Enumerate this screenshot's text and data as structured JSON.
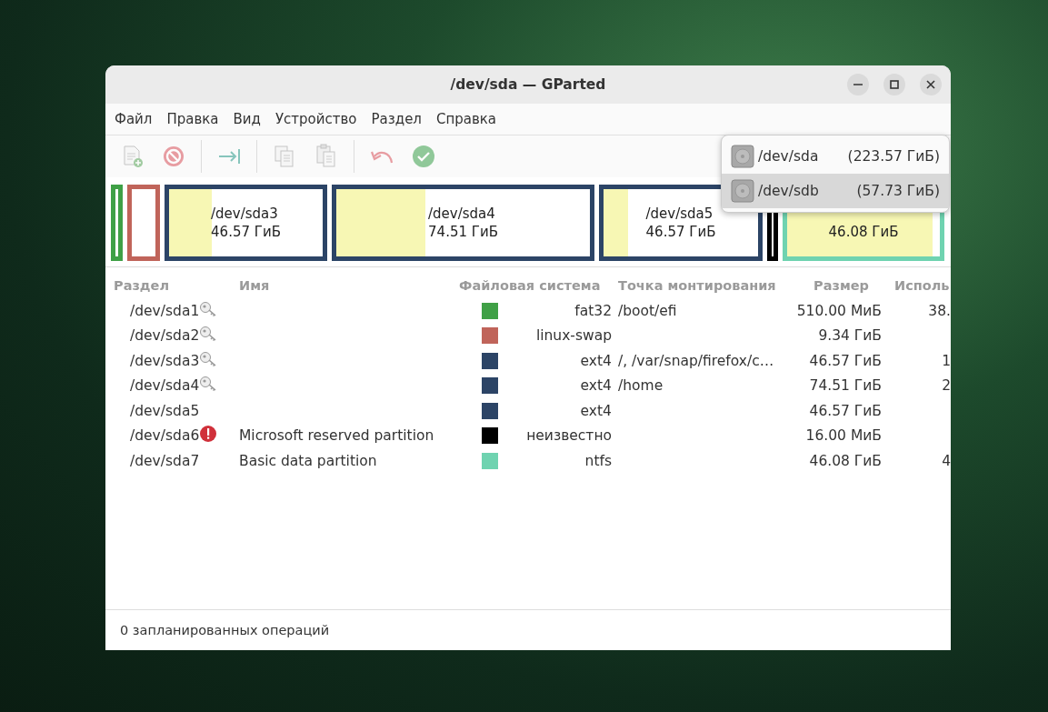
{
  "window": {
    "title": "/dev/sda — GParted"
  },
  "menu": [
    "Файл",
    "Правка",
    "Вид",
    "Устройство",
    "Раздел",
    "Справка"
  ],
  "toolbar": [
    [
      {
        "kind": "new",
        "disabled": true
      },
      {
        "kind": "delete",
        "disabled": true
      }
    ],
    [
      {
        "kind": "resize",
        "disabled": true
      }
    ],
    [
      {
        "kind": "copy",
        "disabled": true
      },
      {
        "kind": "paste",
        "disabled": true
      }
    ],
    [
      {
        "kind": "undo",
        "disabled": true
      },
      {
        "kind": "apply",
        "disabled": true
      }
    ]
  ],
  "disk_map": [
    {
      "color": "#3fa046"
    },
    {
      "color": "#c0645a"
    },
    {
      "color": "#2c4466",
      "level": 0.28,
      "name": "/dev/sda3",
      "size": "46.57 ГиБ"
    },
    {
      "color": "#2c4466",
      "level": 0.35,
      "name": "/dev/sda4",
      "size": "74.51 ГиБ"
    },
    {
      "color": "#2c4466",
      "level": 0.16,
      "name": "/dev/sda5",
      "size": "46.57 ГиБ"
    },
    {
      "color": "#000000"
    },
    {
      "color": "#6fd3b0",
      "level": 0.95,
      "size": "46.08 ГиБ"
    }
  ],
  "device_menu": [
    {
      "device": "/dev/sda",
      "size": "(223.57 ГиБ)",
      "highlighted": false
    },
    {
      "device": "/dev/sdb",
      "size": "(57.73 ГиБ)",
      "highlighted": true
    }
  ],
  "table": {
    "columns": [
      "Раздел",
      "Имя",
      "Файловая система",
      "Точка монтирования",
      "Размер",
      "Исполь"
    ],
    "rows": [
      {
        "partition": "/dev/sda1",
        "busy": true,
        "warning": false,
        "color": "#3fa046",
        "fs": "fat32",
        "mount": "/boot/efi",
        "size": "510.00 МиБ",
        "used": "38."
      },
      {
        "partition": "/dev/sda2",
        "busy": true,
        "warning": false,
        "color": "#c0645a",
        "fs": "linux-swap",
        "size": "9.34 ГиБ"
      },
      {
        "partition": "/dev/sda3",
        "busy": true,
        "warning": false,
        "color": "#2c4466",
        "fs": "ext4",
        "mount": "/, /var/snap/firefox/c…",
        "size": "46.57 ГиБ",
        "used": "1"
      },
      {
        "partition": "/dev/sda4",
        "busy": true,
        "warning": false,
        "color": "#2c4466",
        "fs": "ext4",
        "mount": "/home",
        "size": "74.51 ГиБ",
        "used": "2"
      },
      {
        "partition": "/dev/sda5",
        "busy": false,
        "warning": false,
        "color": "#2c4466",
        "fs": "ext4",
        "size": "46.57 ГиБ"
      },
      {
        "partition": "/dev/sda6",
        "busy": false,
        "warning": true,
        "name": "Microsoft reserved partition",
        "color": "#000000",
        "fs": "неизвестно",
        "size": "16.00 МиБ"
      },
      {
        "partition": "/dev/sda7",
        "busy": false,
        "warning": false,
        "name": "Basic data partition",
        "color": "#6fd3b0",
        "fs": "ntfs",
        "size": "46.08 ГиБ",
        "used": "4"
      }
    ]
  },
  "status_bar": "0 запланированных операций"
}
